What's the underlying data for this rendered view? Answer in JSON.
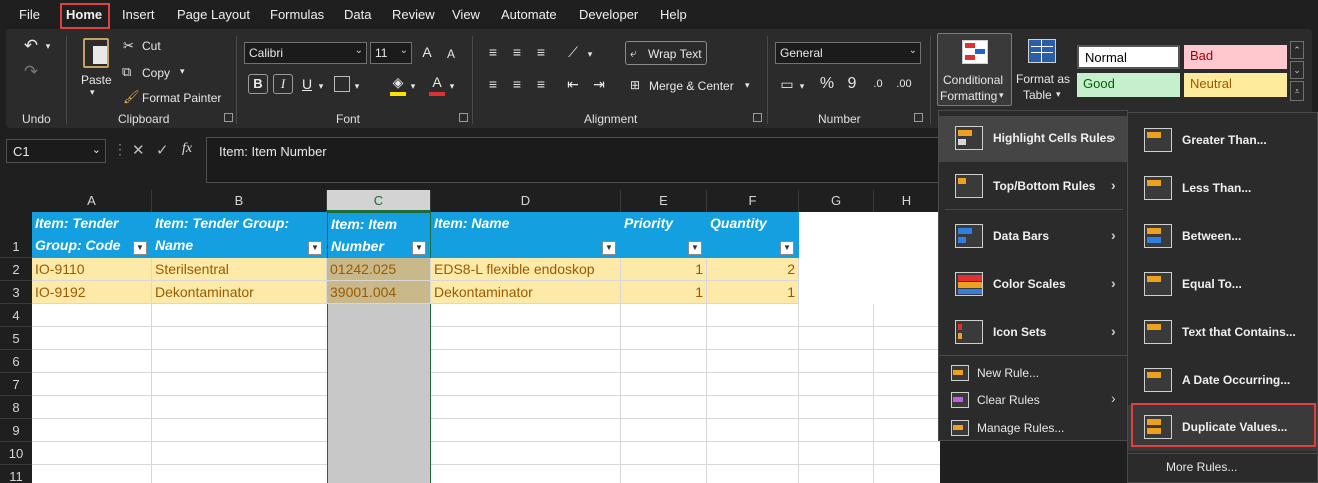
{
  "menubar": {
    "tabs": [
      "File",
      "Home",
      "Insert",
      "Page Layout",
      "Formulas",
      "Data",
      "Review",
      "View",
      "Automate",
      "Developer",
      "Help"
    ]
  },
  "ribbon": {
    "undo_label": "Undo",
    "clipboard": {
      "paste": "Paste",
      "cut": "Cut",
      "copy": "Copy",
      "format_painter": "Format Painter",
      "group": "Clipboard"
    },
    "font": {
      "name": "Calibri",
      "size": "11",
      "bold": "B",
      "italic": "I",
      "underline": "U",
      "grow": "A",
      "shrink": "A",
      "group": "Font"
    },
    "alignment": {
      "wrap_text": "Wrap Text",
      "merge_center": "Merge & Center",
      "group": "Alignment"
    },
    "number": {
      "format": "General",
      "percent": "%",
      "comma": "9",
      "group": "Number"
    },
    "styles": {
      "conditional_formatting_line1": "Conditional",
      "conditional_formatting_line2": "Formatting",
      "format_as_table_line1": "Format as",
      "format_as_table_line2": "Table",
      "normal": "Normal",
      "bad": "Bad",
      "good": "Good",
      "neutral": "Neutral"
    }
  },
  "formula_bar": {
    "name_box": "C1",
    "fx": "fx",
    "content": "Item: Item Number"
  },
  "columns": [
    "A",
    "B",
    "C",
    "D",
    "E",
    "F",
    "G",
    "H"
  ],
  "rows": [
    "1",
    "2",
    "3",
    "4",
    "5",
    "6",
    "7",
    "8",
    "9",
    "10",
    "11"
  ],
  "table": {
    "headers": [
      "Item: Tender Group: Code",
      "Item: Tender Group: Name",
      "Item: Item Number",
      "Item: Name",
      "Priority",
      "Quantity"
    ],
    "data": [
      [
        "IO-9110",
        "Sterilsentral",
        "01242.025",
        "EDS8-L flexible endoskop",
        "1",
        "2"
      ],
      [
        "IO-9192",
        "Dekontaminator",
        "39001.004",
        "Dekontaminator",
        "1",
        "1"
      ]
    ]
  },
  "cf_menu": {
    "items": [
      "Highlight Cells Rules",
      "Top/Bottom Rules",
      "Data Bars",
      "Color Scales",
      "Icon Sets"
    ],
    "small_items": [
      "New Rule...",
      "Clear Rules",
      "Manage Rules..."
    ]
  },
  "highlight_submenu": {
    "items": [
      "Greater Than...",
      "Less Than...",
      "Between...",
      "Equal To...",
      "Text that Contains...",
      "A Date Occurring...",
      "Duplicate Values..."
    ],
    "more_rules": "More Rules..."
  },
  "colors": {
    "accent_red": "#e04040",
    "table_header": "#14a0e0",
    "row_fill": "#fde9a8",
    "selected_col": "#c8c8c8"
  }
}
